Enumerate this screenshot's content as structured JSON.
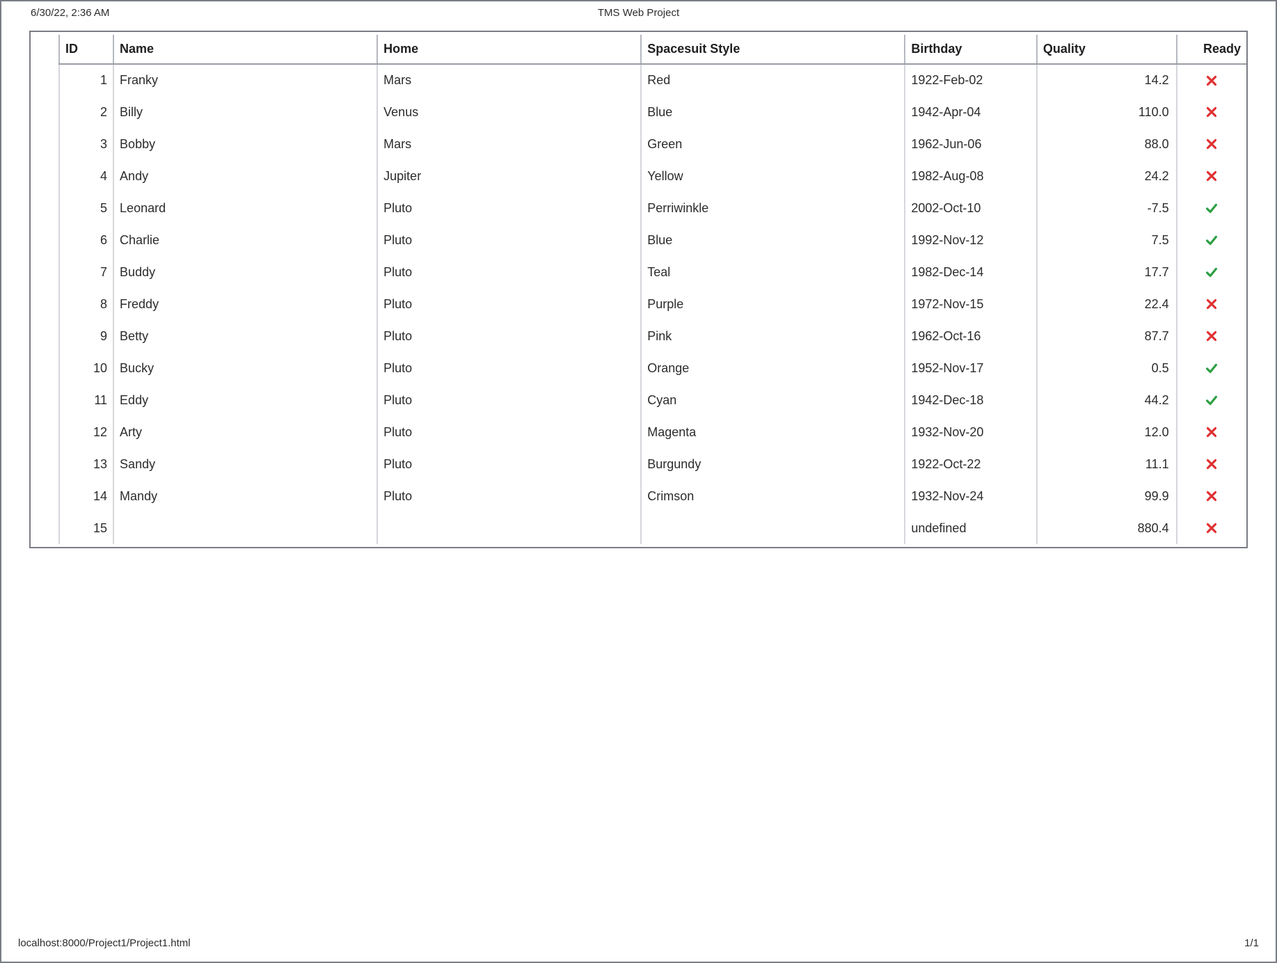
{
  "header": {
    "timestamp": "6/30/22, 2:36 AM",
    "title": "TMS Web Project"
  },
  "footer": {
    "url": "localhost:8000/Project1/Project1.html",
    "pagination": "1/1"
  },
  "table": {
    "columns": {
      "id": "ID",
      "name": "Name",
      "home": "Home",
      "style": "Spacesuit Style",
      "birthday": "Birthday",
      "quality": "Quality",
      "ready": "Ready"
    },
    "rows": [
      {
        "id": "1",
        "name": "Franky",
        "home": "Mars",
        "style": "Red",
        "birthday": "1922-Feb-02",
        "quality": "14.2",
        "ready": false
      },
      {
        "id": "2",
        "name": "Billy",
        "home": "Venus",
        "style": "Blue",
        "birthday": "1942-Apr-04",
        "quality": "110.0",
        "ready": false
      },
      {
        "id": "3",
        "name": "Bobby",
        "home": "Mars",
        "style": "Green",
        "birthday": "1962-Jun-06",
        "quality": "88.0",
        "ready": false
      },
      {
        "id": "4",
        "name": "Andy",
        "home": "Jupiter",
        "style": "Yellow",
        "birthday": "1982-Aug-08",
        "quality": "24.2",
        "ready": false
      },
      {
        "id": "5",
        "name": "Leonard",
        "home": "Pluto",
        "style": "Perriwinkle",
        "birthday": "2002-Oct-10",
        "quality": "-7.5",
        "ready": true
      },
      {
        "id": "6",
        "name": "Charlie",
        "home": "Pluto",
        "style": "Blue",
        "birthday": "1992-Nov-12",
        "quality": "7.5",
        "ready": true
      },
      {
        "id": "7",
        "name": "Buddy",
        "home": "Pluto",
        "style": "Teal",
        "birthday": "1982-Dec-14",
        "quality": "17.7",
        "ready": true
      },
      {
        "id": "8",
        "name": "Freddy",
        "home": "Pluto",
        "style": "Purple",
        "birthday": "1972-Nov-15",
        "quality": "22.4",
        "ready": false
      },
      {
        "id": "9",
        "name": "Betty",
        "home": "Pluto",
        "style": "Pink",
        "birthday": "1962-Oct-16",
        "quality": "87.7",
        "ready": false
      },
      {
        "id": "10",
        "name": "Bucky",
        "home": "Pluto",
        "style": "Orange",
        "birthday": "1952-Nov-17",
        "quality": "0.5",
        "ready": true
      },
      {
        "id": "11",
        "name": "Eddy",
        "home": "Pluto",
        "style": "Cyan",
        "birthday": "1942-Dec-18",
        "quality": "44.2",
        "ready": true
      },
      {
        "id": "12",
        "name": "Arty",
        "home": "Pluto",
        "style": "Magenta",
        "birthday": "1932-Nov-20",
        "quality": "12.0",
        "ready": false
      },
      {
        "id": "13",
        "name": "Sandy",
        "home": "Pluto",
        "style": "Burgundy",
        "birthday": "1922-Oct-22",
        "quality": "11.1",
        "ready": false
      },
      {
        "id": "14",
        "name": "Mandy",
        "home": "Pluto",
        "style": "Crimson",
        "birthday": "1932-Nov-24",
        "quality": "99.9",
        "ready": false
      },
      {
        "id": "15",
        "name": "",
        "home": "",
        "style": "",
        "birthday": "undefined",
        "quality": "880.4",
        "ready": false
      }
    ]
  }
}
